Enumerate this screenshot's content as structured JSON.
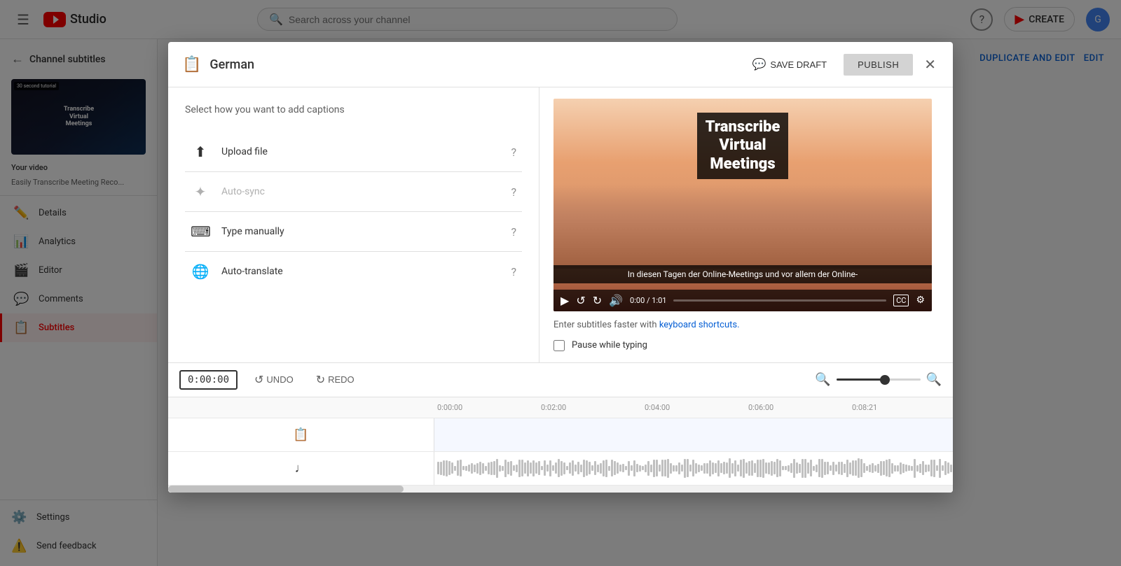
{
  "topbar": {
    "logo_text": "Studio",
    "search_placeholder": "Search across your channel",
    "create_label": "CREATE",
    "avatar_letter": "G"
  },
  "sidebar": {
    "back_label": "Channel subtitles",
    "video_title": "Your video",
    "video_subtitle": "Easily Transcribe Meeting Reco...",
    "thumb_text": "Transcribe\nVirtual\nMeetings",
    "thumb_badge": "30 second tutorial",
    "items": [
      {
        "id": "details",
        "label": "Details",
        "icon": "✏️"
      },
      {
        "id": "analytics",
        "label": "Analytics",
        "icon": "📊"
      },
      {
        "id": "editor",
        "label": "Editor",
        "icon": "🎬"
      },
      {
        "id": "comments",
        "label": "Comments",
        "icon": "💬"
      },
      {
        "id": "subtitles",
        "label": "Subtitles",
        "icon": "📋",
        "active": true
      }
    ],
    "bottom_items": [
      {
        "id": "settings",
        "label": "Settings",
        "icon": "⚙️"
      },
      {
        "id": "feedback",
        "label": "Send feedback",
        "icon": "⚠️"
      }
    ]
  },
  "main": {
    "duplicate_label": "DUPLICATE AND EDIT",
    "edit_label": "EDIT"
  },
  "modal": {
    "title": "German",
    "save_draft_label": "SAVE DRAFT",
    "publish_label": "PUBLISH",
    "caption_panel_title": "Select how you want to add captions",
    "options": [
      {
        "id": "upload",
        "label": "Upload file",
        "icon": "⬆",
        "disabled": false
      },
      {
        "id": "autosync",
        "label": "Auto-sync",
        "icon": "✦",
        "disabled": true
      },
      {
        "id": "manual",
        "label": "Type manually",
        "icon": "⌨",
        "disabled": false
      },
      {
        "id": "autotranslate",
        "label": "Auto-translate",
        "icon": "🌐",
        "disabled": false
      }
    ],
    "video": {
      "title_line1": "Transcribe",
      "title_line2": "Virtual",
      "title_line3": "Meetings",
      "subtitle_text": "In diesen Tagen der Online-Meetings und vor allem der Online-",
      "time_current": "0:00",
      "time_total": "1:01"
    },
    "keyboard_hint": "Enter subtitles faster with",
    "keyboard_link": "keyboard shortcuts.",
    "pause_label": "Pause while typing",
    "timeline": {
      "time": "0:00:00",
      "undo_label": "UNDO",
      "redo_label": "REDO",
      "marks": [
        "0:00:00",
        "0:02:00",
        "0:04:00",
        "0:06:00",
        "0:08:21"
      ],
      "end_time": "0:08:21"
    }
  }
}
